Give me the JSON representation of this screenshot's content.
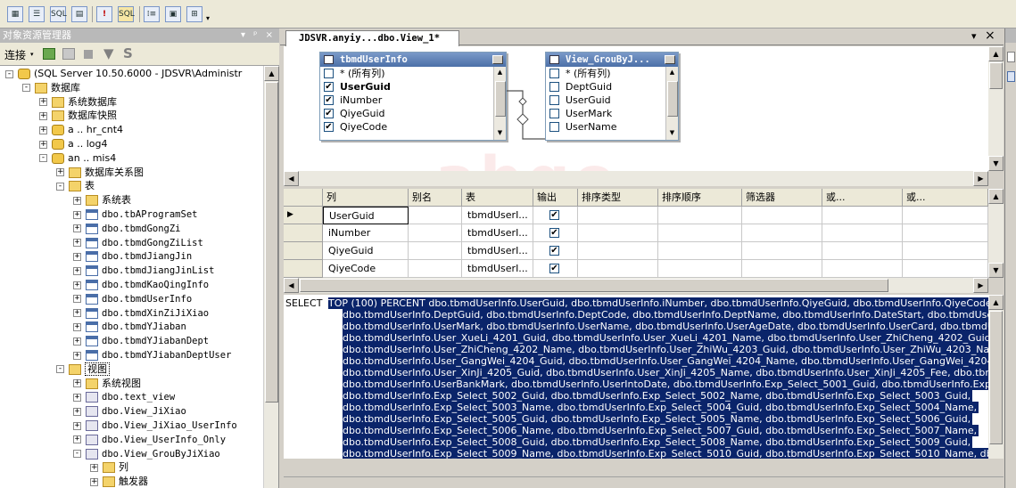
{
  "toolbar": {
    "icons": [
      "diagram-pane-icon",
      "grid-pane-icon",
      "sql-pane-icon",
      "results-pane-icon",
      "execute-icon",
      "verify-sql-icon",
      "group-by-icon",
      "add-table-icon",
      "add-derived-table-icon"
    ],
    "labels": {
      "sql": "SQL"
    }
  },
  "object_explorer": {
    "title": "对象资源管理器",
    "pin": "▾ ᵖ ×",
    "connect_label": "连接",
    "tree": [
      {
        "label": "(SQL Server 10.50.6000 - JDSVR\\Administr",
        "level": 0,
        "icon": "server",
        "exp": "-"
      },
      {
        "label": "数据库",
        "level": 1,
        "icon": "folder",
        "exp": "-"
      },
      {
        "label": "系统数据库",
        "level": 2,
        "icon": "folder",
        "exp": "+"
      },
      {
        "label": "数据库快照",
        "level": 2,
        "icon": "folder",
        "exp": "+"
      },
      {
        "label": "a  ..  hr_cnt4",
        "level": 2,
        "icon": "db",
        "exp": "+"
      },
      {
        "label": "a  .. log4",
        "level": 2,
        "icon": "db",
        "exp": "+"
      },
      {
        "label": "an ..  mis4",
        "level": 2,
        "icon": "db",
        "exp": "-"
      },
      {
        "label": "数据库关系图",
        "level": 3,
        "icon": "folder",
        "exp": "+"
      },
      {
        "label": "表",
        "level": 3,
        "icon": "folder",
        "exp": "-"
      },
      {
        "label": "系统表",
        "level": 4,
        "icon": "folder",
        "exp": "+"
      },
      {
        "label": "dbo.tbAProgramSet",
        "level": 4,
        "icon": "table",
        "exp": "+",
        "mono": true
      },
      {
        "label": "dbo.tbmdGongZi",
        "level": 4,
        "icon": "table",
        "exp": "+",
        "mono": true
      },
      {
        "label": "dbo.tbmdGongZiList",
        "level": 4,
        "icon": "table",
        "exp": "+",
        "mono": true
      },
      {
        "label": "dbo.tbmdJiangJin",
        "level": 4,
        "icon": "table",
        "exp": "+",
        "mono": true
      },
      {
        "label": "dbo.tbmdJiangJinList",
        "level": 4,
        "icon": "table",
        "exp": "+",
        "mono": true
      },
      {
        "label": "dbo.tbmdKaoQingInfo",
        "level": 4,
        "icon": "table",
        "exp": "+",
        "mono": true
      },
      {
        "label": "dbo.tbmdUserInfo",
        "level": 4,
        "icon": "table",
        "exp": "+",
        "mono": true
      },
      {
        "label": "dbo.tbmdXinZiJiXiao",
        "level": 4,
        "icon": "table",
        "exp": "+",
        "mono": true
      },
      {
        "label": "dbo.tbmdYJiaban",
        "level": 4,
        "icon": "table",
        "exp": "+",
        "mono": true
      },
      {
        "label": "dbo.tbmdYJiabanDept",
        "level": 4,
        "icon": "table",
        "exp": "+",
        "mono": true
      },
      {
        "label": "dbo.tbmdYJiabanDeptUser",
        "level": 4,
        "icon": "table",
        "exp": "+",
        "mono": true
      },
      {
        "label": "视图",
        "level": 3,
        "icon": "folder",
        "exp": "-",
        "selected": true
      },
      {
        "label": "系统视图",
        "level": 4,
        "icon": "folder",
        "exp": "+"
      },
      {
        "label": "dbo.text_view",
        "level": 4,
        "icon": "view",
        "exp": "+",
        "mono": true
      },
      {
        "label": "dbo.View_JiXiao",
        "level": 4,
        "icon": "view",
        "exp": "+",
        "mono": true
      },
      {
        "label": "dbo.View_JiXiao_UserInfo",
        "level": 4,
        "icon": "view",
        "exp": "+",
        "mono": true
      },
      {
        "label": "dbo.View_UserInfo_Only",
        "level": 4,
        "icon": "view",
        "exp": "+",
        "mono": true
      },
      {
        "label": "dbo.View_GrouByJiXiao",
        "level": 4,
        "icon": "view",
        "exp": "-",
        "mono": true
      },
      {
        "label": "列",
        "level": 5,
        "icon": "folder",
        "exp": "+"
      },
      {
        "label": "触发器",
        "level": 5,
        "icon": "folder",
        "exp": "+"
      }
    ]
  },
  "document": {
    "tab_title": "JDSVR.anyiy...dbo.View_1*",
    "tab_close": "×",
    "tab_menu": "▾",
    "diagram": {
      "tables": [
        {
          "title": "tbmdUserInfo",
          "rows": [
            {
              "label": "* (所有列)",
              "checked": false,
              "bold": false
            },
            {
              "label": "UserGuid",
              "checked": true,
              "bold": true
            },
            {
              "label": "iNumber",
              "checked": true,
              "bold": false
            },
            {
              "label": "QiyeGuid",
              "checked": true,
              "bold": false
            },
            {
              "label": "QiyeCode",
              "checked": true,
              "bold": false
            }
          ]
        },
        {
          "title": "View_GrouByJ...",
          "rows": [
            {
              "label": "* (所有列)",
              "checked": false,
              "bold": false
            },
            {
              "label": "DeptGuid",
              "checked": false,
              "bold": false
            },
            {
              "label": "UserGuid",
              "checked": false,
              "bold": false
            },
            {
              "label": "UserMark",
              "checked": false,
              "bold": false
            },
            {
              "label": "UserName",
              "checked": false,
              "bold": false
            }
          ]
        }
      ]
    },
    "grid": {
      "headers": [
        "列",
        "别名",
        "表",
        "输出",
        "排序类型",
        "排序顺序",
        "筛选器",
        "或...",
        "或..."
      ],
      "rows": [
        {
          "column": "UserGuid",
          "alias": "",
          "table": "tbmdUserI...",
          "output": true,
          "current": true
        },
        {
          "column": "iNumber",
          "alias": "",
          "table": "tbmdUserI...",
          "output": true,
          "current": false
        },
        {
          "column": "QiyeGuid",
          "alias": "",
          "table": "tbmdUserI...",
          "output": true,
          "current": false
        },
        {
          "column": "QiyeCode",
          "alias": "",
          "table": "tbmdUserI...",
          "output": true,
          "current": false
        }
      ]
    },
    "sql": {
      "keyword": "SELECT",
      "lines": [
        "TOP (100) PERCENT dbo.tbmdUserInfo.UserGuid, dbo.tbmdUserInfo.iNumber, dbo.tbmdUserInfo.QiyeGuid, dbo.tbmdUserInfo.QiyeCode, dbo.tbmdUserInfo.",
        "dbo.tbmdUserInfo.DeptGuid, dbo.tbmdUserInfo.DeptCode, dbo.tbmdUserInfo.DeptName, dbo.tbmdUserInfo.DateStart, dbo.tbmdUserInfo.DateEnd, d",
        "dbo.tbmdUserInfo.UserMark, dbo.tbmdUserInfo.UserName, dbo.tbmdUserInfo.UserAgeDate, dbo.tbmdUserInfo.UserCard, dbo.tbmdUserInfo.UserSe",
        "dbo.tbmdUserInfo.User_XueLi_4201_Guid, dbo.tbmdUserInfo.User_XueLi_4201_Name, dbo.tbmdUserInfo.User_ZhiCheng_4202_Guid,",
        "dbo.tbmdUserInfo.User_ZhiCheng_4202_Name, dbo.tbmdUserInfo.User_ZhiWu_4203_Guid, dbo.tbmdUserInfo.User_ZhiWu_4203_Name,",
        "dbo.tbmdUserInfo.User_GangWei_4204_Guid, dbo.tbmdUserInfo.User_GangWei_4204_Name, dbo.tbmdUserInfo.User_GangWei_4204_Fee,",
        "dbo.tbmdUserInfo.User_XinJi_4205_Guid, dbo.tbmdUserInfo.User_XinJi_4205_Name, dbo.tbmdUserInfo.User_XinJi_4205_Fee, dbo.tbmdUserInfo.Us",
        "dbo.tbmdUserInfo.UserBankMark, dbo.tbmdUserInfo.UserIntoDate, dbo.tbmdUserInfo.Exp_Select_5001_Guid, dbo.tbmdUserInfo.Exp_Select_5001",
        "dbo.tbmdUserInfo.Exp_Select_5002_Guid, dbo.tbmdUserInfo.Exp_Select_5002_Name, dbo.tbmdUserInfo.Exp_Select_5003_Guid,",
        "dbo.tbmdUserInfo.Exp_Select_5003_Name, dbo.tbmdUserInfo.Exp_Select_5004_Guid, dbo.tbmdUserInfo.Exp_Select_5004_Name,",
        "dbo.tbmdUserInfo.Exp_Select_5005_Guid, dbo.tbmdUserInfo.Exp_Select_5005_Name, dbo.tbmdUserInfo.Exp_Select_5006_Guid,",
        "dbo.tbmdUserInfo.Exp_Select_5006_Name, dbo.tbmdUserInfo.Exp_Select_5007_Guid, dbo.tbmdUserInfo.Exp_Select_5007_Name,",
        "dbo.tbmdUserInfo.Exp_Select_5008_Guid, dbo.tbmdUserInfo.Exp_Select_5008_Name, dbo.tbmdUserInfo.Exp_Select_5009_Guid,",
        "dbo.tbmdUserInfo.Exp_Select_5009_Name, dbo.tbmdUserInfo.Exp_Select_5010_Guid, dbo.tbmdUserInfo.Exp_Select_5010_Name, dbo.tbmdUserInf"
      ]
    }
  },
  "colors": {
    "selection": "#0a246a",
    "title_bar": "#4c70a8",
    "panel": "#d4d0c8"
  }
}
